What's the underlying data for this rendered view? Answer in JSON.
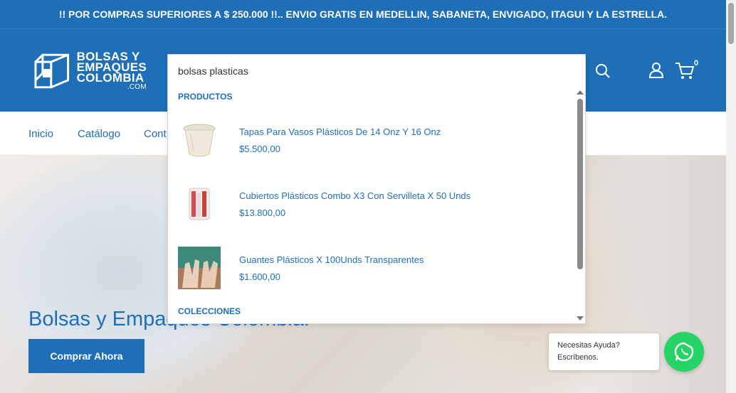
{
  "announcement": "!! POR COMPRAS SUPERIORES A $ 250.000 !!.. ENVIO GRATIS EN MEDELLIN, SABANETA, ENVIGADO, ITAGUI Y LA ESTRELLA.",
  "brand": {
    "line1": "BOLSAS Y",
    "line2": "EMPAQUES",
    "line3": "COLOMBIA",
    "line4": ".COM"
  },
  "header": {
    "cart_count": "0",
    "search_icon": "search-icon",
    "account_icon": "user-icon",
    "cart_icon": "cart-icon"
  },
  "nav": {
    "items": [
      "Inicio",
      "Catálogo",
      "Cont"
    ]
  },
  "search": {
    "value": "bolsas plasticas",
    "products_heading": "PRODUCTOS",
    "collections_heading": "COLECCIONES",
    "results": [
      {
        "name": "Tapas Para Vasos Plásticos De 14 Onz Y 16 Onz",
        "price": "$5.500,00"
      },
      {
        "name": "Cubiertos Plásticos Combo X3 Con Servilleta X 50 Unds",
        "price": "$13.800,00"
      },
      {
        "name": "Guantes Plásticos X 100Unds Transparentes",
        "price": "$1.600,00"
      }
    ]
  },
  "hero": {
    "title": "Bolsas y Empaques Colombia.",
    "button": "Comprar Ahora"
  },
  "whatsapp": {
    "line1": "Necesitas Ayuda?",
    "line2": "Escríbenos.",
    "icon": "whatsapp-icon"
  },
  "colors": {
    "primary": "#1e6fb8",
    "whatsapp": "#25d366"
  }
}
